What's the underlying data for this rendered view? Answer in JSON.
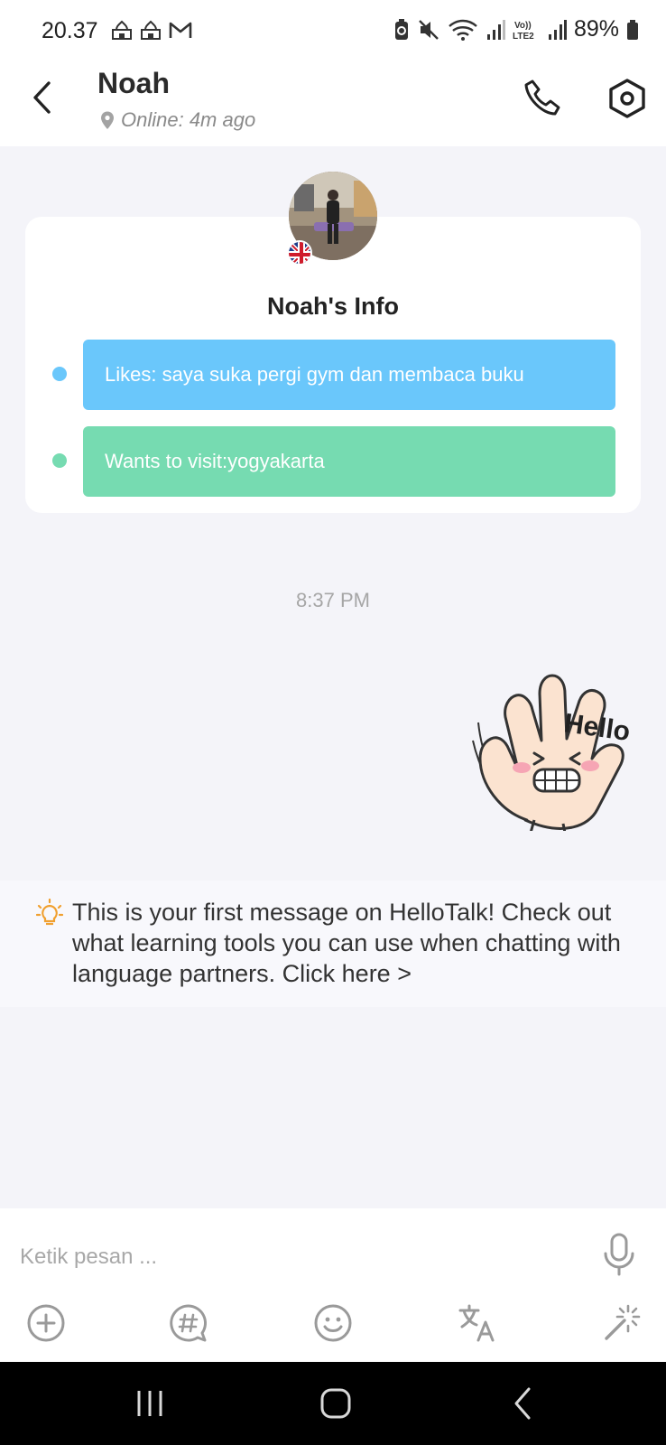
{
  "status_bar": {
    "time": "20.37",
    "left_icons": [
      "mosque-icon",
      "mosque-icon",
      "gmail-icon"
    ],
    "right_icons": [
      "battery-saver-icon",
      "mute-icon",
      "wifi-icon",
      "signal-icon",
      "volte-icon",
      "signal-icon"
    ],
    "battery": "89%"
  },
  "header": {
    "name": "Noah",
    "status": "Online: 4m ago"
  },
  "info_card": {
    "title": "Noah's Info",
    "rows": [
      {
        "text": "Likes: saya suka pergi gym dan membaca buku",
        "color": "#6ac7fb"
      },
      {
        "text": "Wants to visit:yogyakarta",
        "color": "#76dbb1"
      }
    ]
  },
  "chat": {
    "timestamp": "8:37 PM",
    "sticker_text": "Hello"
  },
  "tip": {
    "text": "This is your first message on HelloTalk! Check out what learning tools you can use when chatting with language partners. Click here >"
  },
  "composer": {
    "placeholder": "Ketik pesan ...",
    "tools": [
      "plus-icon",
      "hashtag-icon",
      "emoji-icon",
      "translate-icon",
      "magic-icon"
    ]
  },
  "colors": {
    "accent_blue": "#6ac7fb",
    "accent_green": "#76dbb1",
    "tip_icon": "#f0a030"
  }
}
